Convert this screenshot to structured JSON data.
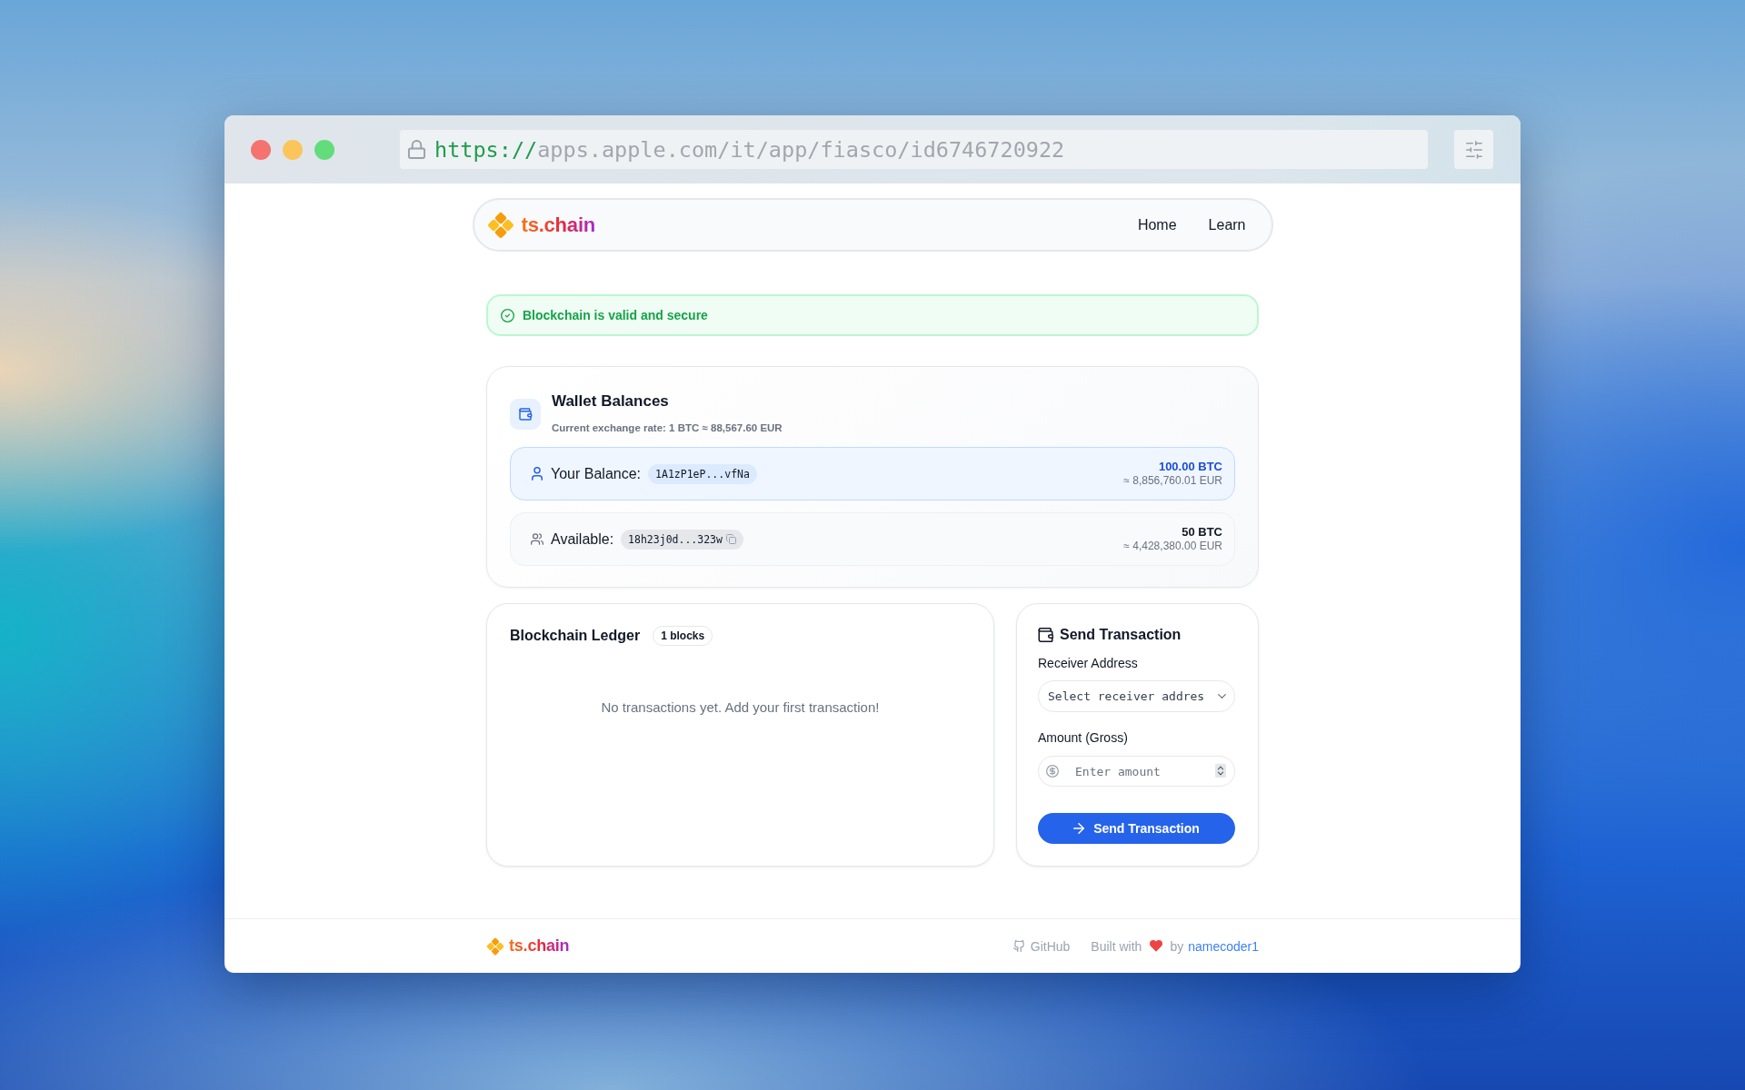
{
  "browser": {
    "scheme": "https://",
    "address": "apps.apple.com/it/app/fiasco/id6746720922"
  },
  "navbar": {
    "logo": "ts.chain",
    "links": [
      {
        "label": "Home"
      },
      {
        "label": "Learn"
      }
    ]
  },
  "status_banner": {
    "valid": true,
    "text": "Blockchain is valid and secure"
  },
  "wallet_balances": {
    "title": "Wallet Balances",
    "exchange_rate": "Current exchange rate: 1 BTC ≈ 88,567.60 EUR",
    "wallets": [
      {
        "kind": "own",
        "label": "Your Balance:",
        "address": "1A1zP1eP...vfNa",
        "copyable": false,
        "btc": "100.00 BTC",
        "eur": "≈ 8,856,760.01 EUR"
      },
      {
        "kind": "other",
        "label": "Available:",
        "address": "18h23j0d...323w",
        "copyable": true,
        "btc": "50 BTC",
        "eur": "≈ 4,428,380.00 EUR"
      }
    ]
  },
  "ledger": {
    "title": "Blockchain Ledger",
    "badge": "1 blocks",
    "empty_message": "No transactions yet. Add your first transaction!"
  },
  "send_transaction": {
    "title": "Send Transaction",
    "fields": [
      {
        "kind": "select",
        "label": "Receiver Address",
        "placeholder": "Select receiver addres"
      },
      {
        "kind": "number",
        "label": "Amount (Gross)",
        "placeholder": "Enter amount"
      }
    ],
    "button": "Send Transaction"
  },
  "footer": {
    "logo": "ts.chain",
    "github": "GitHub",
    "built_with": "Built with",
    "by": "by",
    "author": "namecoder1"
  }
}
